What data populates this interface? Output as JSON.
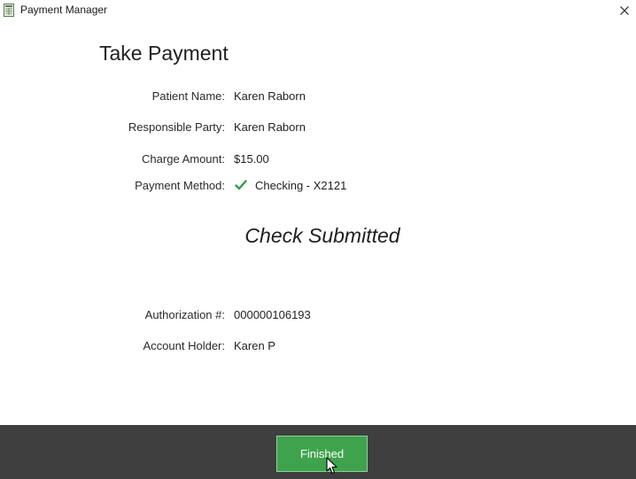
{
  "window": {
    "title": "Payment Manager",
    "app_icon": "spreadsheet-icon",
    "close_icon": "close-icon",
    "close_glyph": "✕"
  },
  "main": {
    "heading": "Take Payment",
    "fields": {
      "patient_name": {
        "label": "Patient Name:",
        "value": "Karen Raborn"
      },
      "responsible_party": {
        "label": "Responsible Party:",
        "value": "Karen Raborn"
      },
      "charge_amount": {
        "label": "Charge Amount:",
        "value": "$15.00"
      },
      "payment_method": {
        "label": "Payment Method:",
        "value": "Checking - X2121",
        "status_icon": "checkmark-icon"
      }
    },
    "status": "Check Submitted",
    "details": {
      "authorization": {
        "label": "Authorization #:",
        "value": "000000106193"
      },
      "account_holder": {
        "label": "Account Holder:",
        "value": "Karen P"
      }
    }
  },
  "footer": {
    "finished_label": "Finished"
  },
  "colors": {
    "accent_green": "#3fa34d",
    "check_green": "#2e9e47",
    "footer_bg": "#3f3f3f"
  }
}
